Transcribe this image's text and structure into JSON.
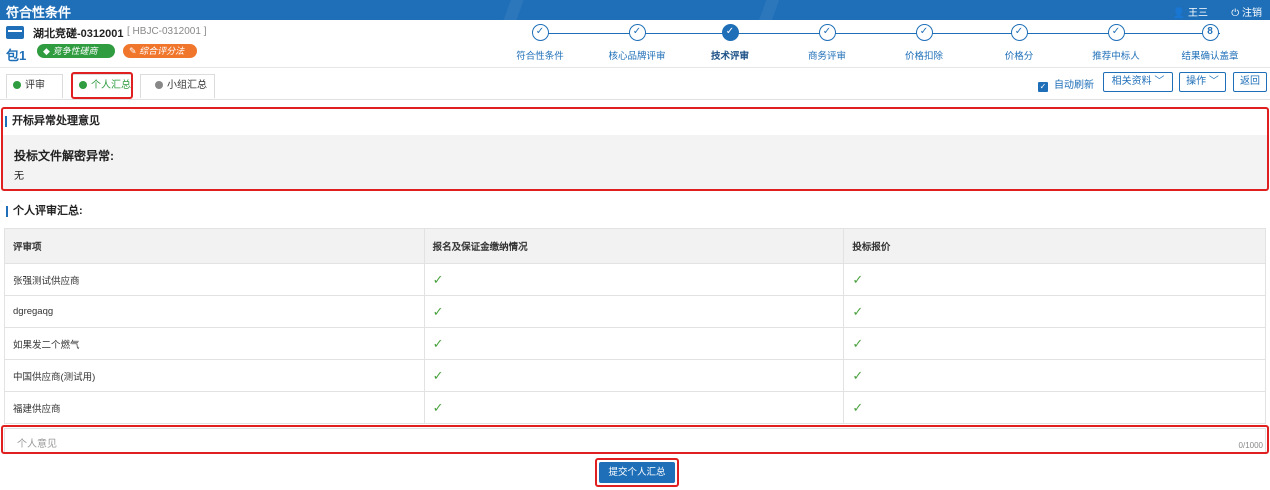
{
  "topbar": {
    "title": "符合性条件",
    "user": "王三",
    "logout": "注销"
  },
  "project": {
    "name": "湖北竞磋-0312001",
    "code": "[ HBJC-0312001 ]",
    "package": "包1",
    "badges": [
      "竞争性磋商",
      "综合评分法"
    ]
  },
  "steps": [
    {
      "label": "符合性条件",
      "mark": "✓"
    },
    {
      "label": "核心品牌评审",
      "mark": "✓"
    },
    {
      "label": "技术评审",
      "mark": "✓"
    },
    {
      "label": "商务评审",
      "mark": "✓"
    },
    {
      "label": "价格扣除",
      "mark": "✓"
    },
    {
      "label": "价格分",
      "mark": "✓"
    },
    {
      "label": "推荐中标人",
      "mark": "✓"
    },
    {
      "label": "结果确认盖章",
      "mark": "8"
    }
  ],
  "tabs": [
    "评审",
    "个人汇总",
    "小组汇总"
  ],
  "toolbar": {
    "auto_refresh": "自动刷新",
    "related": "相关资料",
    "operate": "操作",
    "back": "返回"
  },
  "exception": {
    "title": "开标异常处理意见",
    "question": "投标文件解密异常:",
    "answer": "无"
  },
  "summary": {
    "title": "个人评审汇总:",
    "columns": [
      "评审项",
      "报名及保证金缴纳情况",
      "投标报价"
    ],
    "rows": [
      {
        "name": "张强测试供应商",
        "c1": "✓",
        "c2": "✓"
      },
      {
        "name": "dgregaqg",
        "c1": "✓",
        "c2": "✓"
      },
      {
        "name": "如果发二个燃气",
        "c1": "✓",
        "c2": "✓"
      },
      {
        "name": "中国供应商(测试用)",
        "c1": "✓",
        "c2": "✓"
      },
      {
        "name": "福建供应商",
        "c1": "✓",
        "c2": "✓"
      }
    ]
  },
  "opinion": {
    "placeholder": "个人意见",
    "counter": "0/1000"
  },
  "submit": "提交个人汇总"
}
